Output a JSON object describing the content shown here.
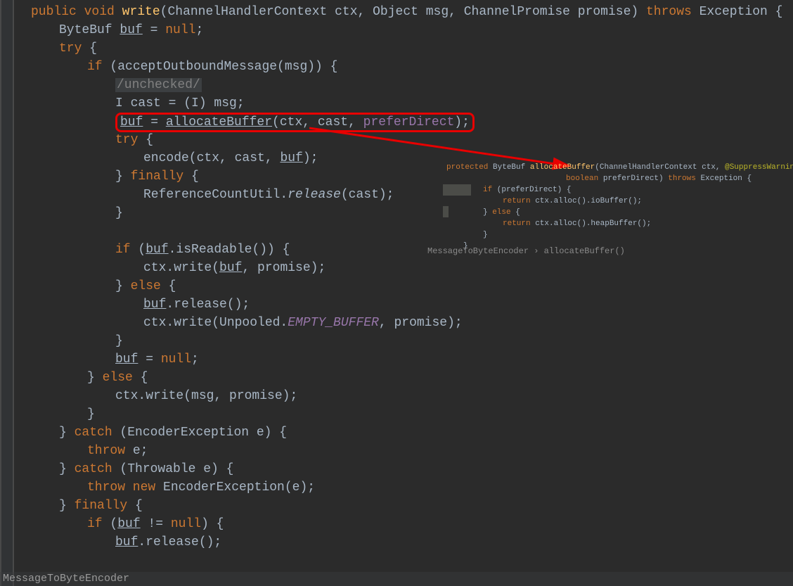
{
  "main": {
    "l0_public": "public",
    "l0_void": "void",
    "l0_method": "write",
    "l0_sig": "(ChannelHandlerContext ctx, Object msg, ChannelPromise promise) ",
    "l0_throws": "throws",
    "l0_exc": " Exception {",
    "l1_ByteBuf": "ByteBuf ",
    "l1_buf": "buf",
    "l1_rest": " = ",
    "l1_null": "null",
    "l1_semi": ";",
    "l2_try": "try",
    "l2_brace": " {",
    "l3_if": "if",
    "l3_cond": " (acceptOutboundMessage(msg)) {",
    "l4_comment": "/unchecked/",
    "l5_cast": "I cast = (I) msg;",
    "l6_buf": "buf",
    "l6_eq": " = ",
    "l6_fn": "allocateBuffer",
    "l6_args_a": "(ctx, cast, ",
    "l6_pref": "preferDirect",
    "l6_args_b": ");",
    "l7_try": "try",
    "l7_brace": " {",
    "l8_enc_a": "encode(ctx, cast, ",
    "l8_buf": "buf",
    "l8_enc_b": ");",
    "l9_close": "} ",
    "l9_finally": "finally",
    "l9_brace": " {",
    "l10_a": "ReferenceCountUtil.",
    "l10_rel": "release",
    "l10_b": "(cast);",
    "l11_close": "}",
    "l12_empty": "",
    "l13_if": "if",
    "l13_a": " (",
    "l13_buf": "buf",
    "l13_b": ".isReadable()) {",
    "l14_a": "ctx.write(",
    "l14_buf": "buf",
    "l14_b": ", promise);",
    "l15_close": "} ",
    "l15_else": "else",
    "l15_brace": " {",
    "l16_buf": "buf",
    "l16_b": ".release();",
    "l17_a": "ctx.write(Unpooled.",
    "l17_eb": "EMPTY_BUFFER",
    "l17_b": ", promise);",
    "l18_close": "}",
    "l19_buf": "buf",
    "l19_rest": " = ",
    "l19_null": "null",
    "l19_semi": ";",
    "l20_close": "} ",
    "l20_else": "else",
    "l20_brace": " {",
    "l21": "ctx.write(msg, promise);",
    "l22_close": "}",
    "l23_close": "} ",
    "l23_catch": "catch",
    "l23_rest": " (EncoderException e) {",
    "l24_throw": "throw",
    "l24_rest": " e;",
    "l25_close": "} ",
    "l25_catch": "catch",
    "l25_rest": " (Throwable e) {",
    "l26_throw": "throw new",
    "l26_rest": " EncoderException(e);",
    "l27_close": "} ",
    "l27_finally": "finally",
    "l27_brace": " {",
    "l28_if": "if",
    "l28_a": " (",
    "l28_buf": "buf",
    "l28_b": " != ",
    "l28_null": "null",
    "l28_c": ") {",
    "l29_buf": "buf",
    "l29_b": ".release();"
  },
  "inset": {
    "l0_protected": "protected",
    "l0_type": " ByteBuf ",
    "l0_method": "allocateBuffer",
    "l0_sig_a": "(ChannelHandlerContext ctx, ",
    "l0_ann": "@SuppressWarnings",
    "l0_sig_b": "(",
    "l1_bool": "boolean",
    "l1_rest": " preferDirect) ",
    "l1_throws": "throws",
    "l1_exc": " Exception {",
    "l2_if": "if",
    "l2_rest": " (preferDirect) {",
    "l3_ret": "return",
    "l3_rest": " ctx.alloc().ioBuffer();",
    "l4_close": "} ",
    "l4_else": "else",
    "l4_brace": " {",
    "l5_ret": "return",
    "l5_rest": " ctx.alloc().heapBuffer();",
    "l6_close": "}",
    "l7_close": "}"
  },
  "nav": {
    "crumb_a": "MessageToByteEncoder",
    "crumb_sep": "  ›  ",
    "crumb_b": "allocateBuffer()"
  },
  "breadcrumb": "MessageToByteEncoder"
}
